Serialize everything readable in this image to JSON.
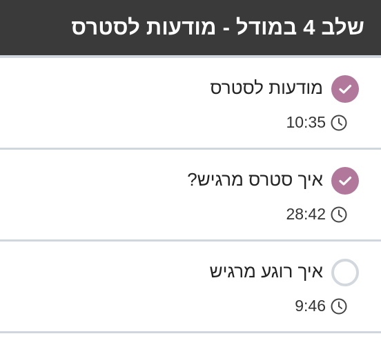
{
  "header": {
    "title": "שלב 4 במודל - מודעות לסטרס"
  },
  "lessons": [
    {
      "title": "מודעות לסטרס",
      "duration": "10:35",
      "status": "completed",
      "icon": "check-circle-icon"
    },
    {
      "title": "איך סטרס מרגיש?",
      "duration": "28:42",
      "status": "completed",
      "icon": "check-circle-icon"
    },
    {
      "title": "איך רוגע מרגיש",
      "duration": "9:46",
      "status": "not-started",
      "icon": "empty-circle-icon"
    }
  ],
  "colors": {
    "header_bg": "#3a3a3a",
    "completed": "#b2789c",
    "divider": "#cfd6dd"
  }
}
